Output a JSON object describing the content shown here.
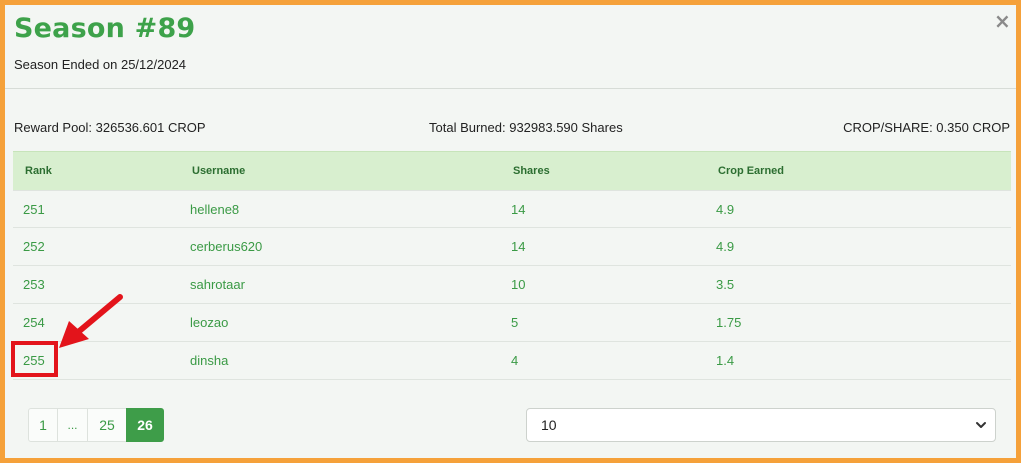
{
  "modal": {
    "title": "Season #89",
    "subtitle": "Season Ended on 25/12/2024",
    "close_label": "×"
  },
  "stats": {
    "reward_pool": "Reward Pool: 326536.601 CROP",
    "total_burned": "Total Burned: 932983.590 Shares",
    "crop_per_share": "CROP/SHARE: 0.350 CROP"
  },
  "table": {
    "headers": [
      "Rank",
      "Username",
      "Shares",
      "Crop Earned"
    ],
    "rows": [
      [
        "251",
        "hellene8",
        "14",
        "4.9"
      ],
      [
        "252",
        "cerberus620",
        "14",
        "4.9"
      ],
      [
        "253",
        "sahrotaar",
        "10",
        "3.5"
      ],
      [
        "254",
        "leozao",
        "5",
        "1.75"
      ],
      [
        "255",
        "dinsha",
        "4",
        "1.4"
      ]
    ]
  },
  "pagination": {
    "pages": [
      "1",
      "...",
      "25",
      "26"
    ],
    "active": "26"
  },
  "page_size": {
    "selected": "10"
  },
  "colors": {
    "accent": "#3da24a",
    "frame": "#f5a13a",
    "annotation": "#e3141b"
  },
  "icons": {
    "close": "close-icon",
    "arrow": "arrow-annotation-icon",
    "select": "chevron-down-icon"
  }
}
